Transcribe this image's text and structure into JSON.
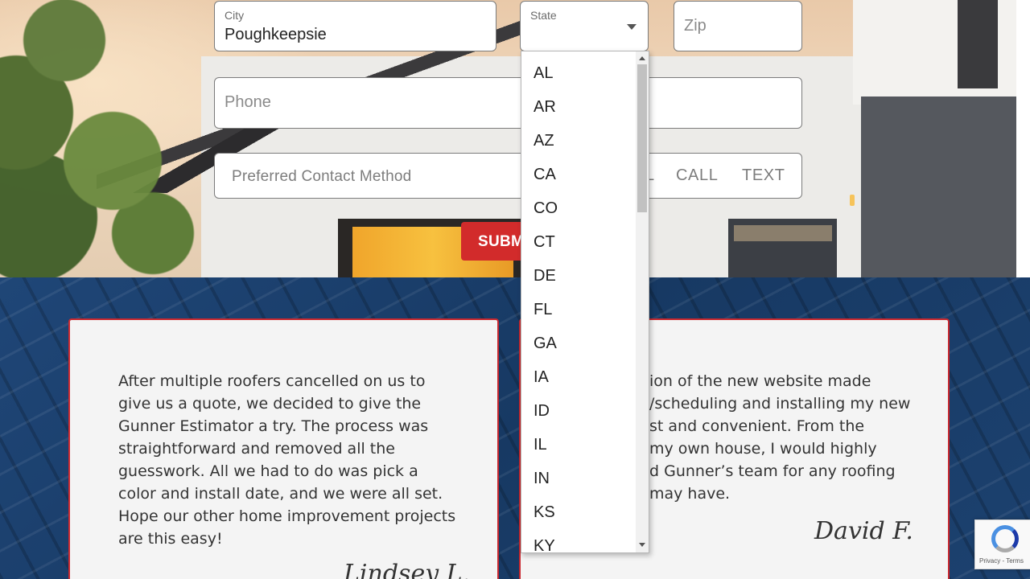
{
  "form": {
    "city": {
      "label": "City",
      "value": "Poughkeepsie"
    },
    "state": {
      "label": "State",
      "value": ""
    },
    "zip": {
      "placeholder": "Zip"
    },
    "phone": {
      "placeholder": "Phone"
    },
    "contact": {
      "label": "Preferred Contact Method",
      "options": [
        "L",
        "CALL",
        "TEXT"
      ]
    },
    "submit_label": "SUBMIT"
  },
  "state_dropdown": {
    "options": [
      "AL",
      "AR",
      "AZ",
      "CA",
      "CO",
      "CT",
      "DE",
      "FL",
      "GA",
      "IA",
      "ID",
      "IL",
      "IN",
      "KS",
      "KY"
    ]
  },
  "testimonials": [
    {
      "text": "After multiple roofers cancelled on us to give us a quote, we decided to give the Gunner Estimator a try. The process was straightforward and removed all the guesswork. All we had to do was pick a color and install date, and we were all set. Hope our other home improvement projects are this easy!",
      "signature": "Lindsey L."
    },
    {
      "text": "The addition of the new website made quoting/scheduling and installing my new roof fast and convenient. From the comfort of my own house, I would highly recommend Gunner’s team for any roofing needs you may have.",
      "visible_lines": [
        "ion of the new website made",
        "/scheduling and installing my new",
        "st and convenient. From the",
        "my own house, I would highly",
        "d Gunner’s team for any roofing",
        "may have."
      ],
      "signature": "David F."
    }
  ],
  "recaptcha": {
    "terms": "Privacy - Terms"
  }
}
